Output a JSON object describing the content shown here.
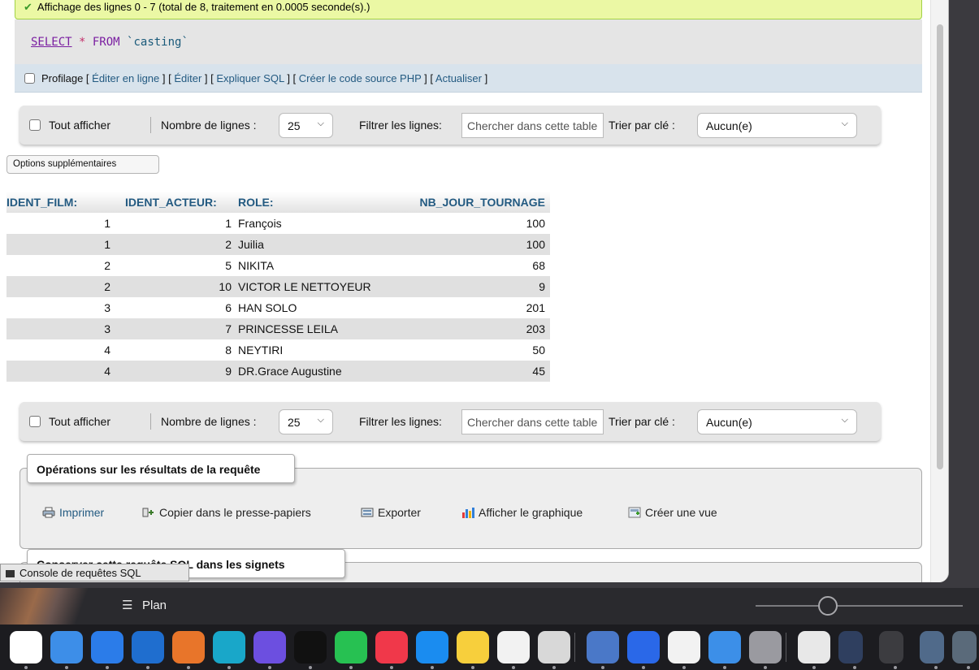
{
  "status": {
    "message": "Affichage des lignes 0 - 7 (total de 8, traitement en 0.0005 seconde(s).)"
  },
  "sql": {
    "kw_select": "SELECT",
    "star": " * ",
    "kw_from": "FROM ",
    "table": "`casting`"
  },
  "profile": {
    "label": "Profilage",
    "open": " [ ",
    "sep": " ] [ ",
    "close": " ]",
    "links": [
      "Éditer en ligne",
      "Éditer",
      "Expliquer SQL",
      "Créer le code source PHP",
      "Actualiser"
    ]
  },
  "nav": {
    "show_all": "Tout afficher",
    "rows_label": "Nombre de lignes :",
    "rows_value": "25",
    "filter_label": "Filtrer les lignes:",
    "filter_placeholder": "Chercher dans cette table",
    "sort_label": "Trier par clé :",
    "sort_value": "Aucun(e)"
  },
  "options_button": "Options supplémentaires",
  "table": {
    "headers": [
      "IDENT_FILM:",
      "IDENT_ACTEUR:",
      "ROLE:",
      "NB_JOUR_TOURNAGE"
    ],
    "rows": [
      [
        "1",
        "1",
        "François",
        "100"
      ],
      [
        "1",
        "2",
        "Juilia",
        "100"
      ],
      [
        "2",
        "5",
        "NIKITA",
        "68"
      ],
      [
        "2",
        "10",
        "VICTOR LE NETTOYEUR",
        "9"
      ],
      [
        "3",
        "6",
        "HAN SOLO",
        "201"
      ],
      [
        "3",
        "7",
        "PRINCESSE LEILA",
        "203"
      ],
      [
        "4",
        "8",
        "NEYTIRI",
        "50"
      ],
      [
        "4",
        "9",
        "DR.Grace Augustine",
        "45"
      ]
    ]
  },
  "operations": {
    "legend": "Opérations sur les résultats de la requête",
    "print": "Imprimer",
    "copy": "Copier dans le presse-papiers",
    "export": "Exporter",
    "chart": "Afficher le graphique",
    "view": "Créer une vue"
  },
  "bookmark": {
    "legend": "Conserver cette requête SQL dans les signets"
  },
  "console": {
    "label": "Console de requêtes SQL"
  },
  "plan": {
    "label": "Plan"
  },
  "dock": {
    "icons": [
      {
        "name": "reminders-icon",
        "color": "#ffffff"
      },
      {
        "name": "freeform-icon",
        "color": "#3d8ee8"
      },
      {
        "name": "safari-icon",
        "color": "#2b7ce9"
      },
      {
        "name": "vscode-icon",
        "color": "#1f6ecf"
      },
      {
        "name": "mamp-icon",
        "color": "#e8752a"
      },
      {
        "name": "canva-icon",
        "color": "#19a7c9"
      },
      {
        "name": "teams-icon",
        "color": "#6c4fe0"
      },
      {
        "name": "appletv-icon",
        "color": "#111111"
      },
      {
        "name": "whatsapp-icon",
        "color": "#27c152"
      },
      {
        "name": "music-icon",
        "color": "#f0384a"
      },
      {
        "name": "appstore-icon",
        "color": "#1a8cf0"
      },
      {
        "name": "notes-icon",
        "color": "#f7cf3c"
      },
      {
        "name": "photos-icon",
        "color": "#f2f2f2"
      },
      {
        "name": "chatgpt-icon",
        "color": "#d8d8d8"
      },
      {
        "name": "preview-icon",
        "color": "#4a78c8"
      },
      {
        "name": "arc-icon",
        "color": "#2a68e8"
      },
      {
        "name": "chrome-icon",
        "color": "#f2f2f2"
      },
      {
        "name": "finder-icon",
        "color": "#3c8fe8"
      },
      {
        "name": "settings-icon",
        "color": "#9a9aa0"
      },
      {
        "name": "document-icon",
        "color": "#e8e8e8"
      },
      {
        "name": "window-thumb-1-icon",
        "color": "#2f3f5f"
      },
      {
        "name": "window-thumb-2-icon",
        "color": "#3c3c40"
      },
      {
        "name": "window-thumb-3-icon",
        "color": "#506a8a"
      },
      {
        "name": "window-thumb-4-icon",
        "color": "#5a6a7a"
      }
    ]
  }
}
